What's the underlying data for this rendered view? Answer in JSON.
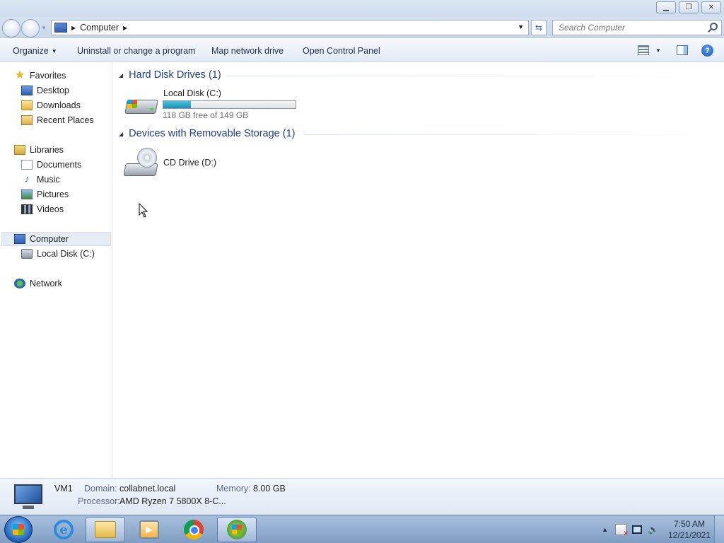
{
  "window": {
    "minimize_glyph": "▁",
    "maximize_glyph": "❐",
    "close_glyph": "✕"
  },
  "address": {
    "location": "Computer",
    "search_placeholder": "Search Computer"
  },
  "toolbar": {
    "organize": "Organize",
    "uninstall": "Uninstall or change a program",
    "map_drive": "Map network drive",
    "control_panel": "Open Control Panel",
    "help": "?"
  },
  "nav": {
    "favorites": "Favorites",
    "desktop": "Desktop",
    "downloads": "Downloads",
    "recent": "Recent Places",
    "libraries": "Libraries",
    "documents": "Documents",
    "music": "Music",
    "pictures": "Pictures",
    "videos": "Videos",
    "computer": "Computer",
    "local_disk": "Local Disk (C:)",
    "network": "Network"
  },
  "content": {
    "hdd_group": "Hard Disk Drives (1)",
    "removable_group": "Devices with Removable Storage (1)",
    "drives": [
      {
        "name": "Local Disk (C:)",
        "free_text": "118 GB free of 149 GB",
        "used_fraction": 0.208
      },
      {
        "name": "CD Drive (D:)"
      }
    ]
  },
  "details": {
    "name": "VM1",
    "domain_label": "Domain:",
    "domain_value": "collabnet.local",
    "memory_label": "Memory:",
    "memory_value": "8.00 GB",
    "processor_label": "Processor:",
    "processor_value": "AMD Ryzen 7 5800X 8-C..."
  },
  "taskbar": {
    "time": "7:50 AM",
    "date": "12/21/2021"
  },
  "colors": {
    "group_header": "#1e3c8c",
    "usage_fill": "#1d8fb8"
  }
}
